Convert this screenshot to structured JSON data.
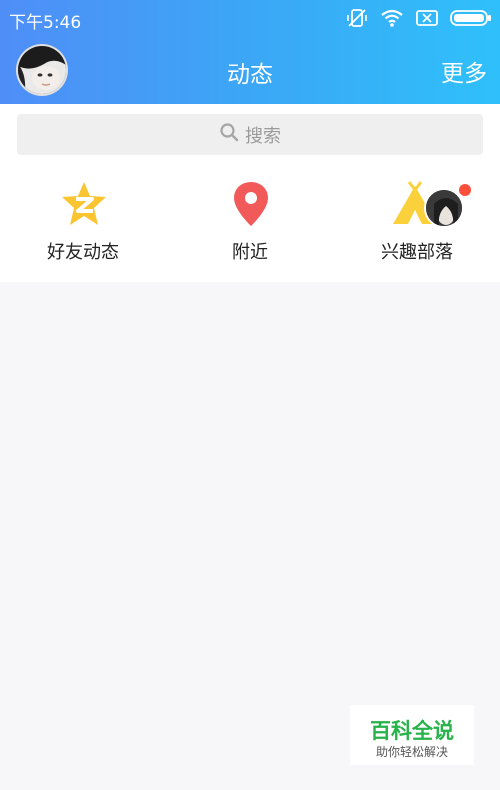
{
  "status_bar": {
    "time": "下午5:46",
    "icons": [
      "vibrate-off-icon",
      "wifi-icon",
      "sim-blocked-icon",
      "battery-icon"
    ]
  },
  "nav": {
    "title": "动态",
    "more_label": "更多"
  },
  "search": {
    "placeholder": "搜索"
  },
  "entries": [
    {
      "label": "好友动态",
      "icon": "qzone-star-icon",
      "color": "#fbc531"
    },
    {
      "label": "附近",
      "icon": "location-pin-icon",
      "color": "#f25a5a"
    },
    {
      "label": "兴趣部落",
      "icon": "tribe-tent-icon",
      "color": "#fbd13b",
      "badge": true,
      "badge_color": "#fa4f3a"
    }
  ],
  "watermark": {
    "title": "百科全说",
    "subtitle": "助你轻松解决"
  },
  "colors": {
    "header_start": "#4f8ef7",
    "header_end": "#2fc0fb",
    "background": "#f7f7f9"
  }
}
